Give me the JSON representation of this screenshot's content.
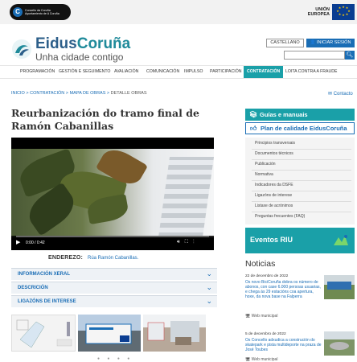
{
  "top": {
    "city_logo_text": "Concello da Coruña\nAyuntamiento de A Coruña",
    "eu_label": "UNIÓN EUROPEA"
  },
  "brand": {
    "name_part1": "Eidus",
    "name_part2": "Coruña",
    "tagline": "Unha cidade contigo"
  },
  "header": {
    "language": "CASTELLANO",
    "login": "INICIAR SESIÓN",
    "search_placeholder": ""
  },
  "nav": {
    "items": [
      "PROGRAMACIÓN",
      "GESTIÓN E SEGUIMENTO",
      "AVALIACIÓN",
      "COMUNICACIÓN",
      "IMPULSO",
      "PARTICIPACIÓN",
      "CONTRATACIÓN",
      "LOITA CONTRA A FRAUDE"
    ],
    "active": "CONTRATACIÓN"
  },
  "breadcrumb": {
    "items": [
      "INICIO",
      "CONTRATACIÓN",
      "MAPA DE OBRAS"
    ],
    "current": "DETALLE OBRAS",
    "contact": "Contacto"
  },
  "main": {
    "title": "Reurbanización do tramo final de Ramón Cabanillas",
    "video_time": "0:00 / 0:42",
    "address_label": "ENDEREZO:",
    "address_value": "Rúa Ramón Cabanillas.",
    "accordions": [
      "INFORMACIÓN XERAL",
      "DESCRICIÓN",
      "LIGAZÓNS DE INTERESE"
    ]
  },
  "sidebar": {
    "guides": "Guías e manuais",
    "quality": "Plan de calidade EidusCoruña",
    "links": [
      "Principios transversais",
      "Documentos técnicos",
      "Publicación",
      "Normativa",
      "Indicadores da DSFE",
      "Ligazóns de interese",
      "Listaxe de acrónimos",
      "Preguntas frecuentes (FAQ)"
    ],
    "events": "Eventos RIU",
    "news_title": "Noticias",
    "news": [
      {
        "date": "22 de decembro de 2022",
        "text": "Os novo BiciCoruña dobra os número de abonos, con case 6.000 persoas usuarias, e chega ás 29 estacións coa apertura, hoxe, da nova base na Falperra",
        "source": "Web municipal"
      },
      {
        "date": "5 de decembro de 2022",
        "text": "Os Concello adxudica a construción do skatepark e pista multideporte na praza de José Toubes",
        "source": "Web municipal"
      }
    ]
  },
  "colors": {
    "accent": "#1aa0a8",
    "link": "#1a6db5"
  }
}
